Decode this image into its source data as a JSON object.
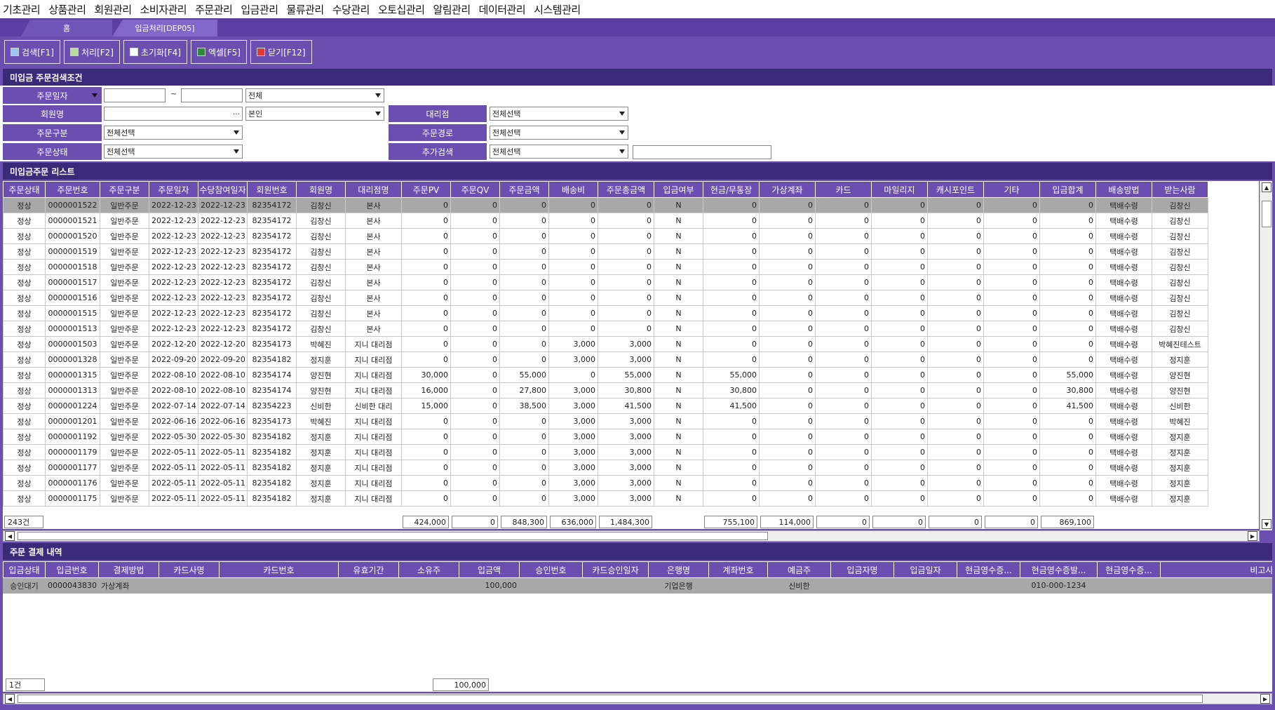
{
  "menu": [
    "기초관리",
    "상품관리",
    "회원관리",
    "소비자관리",
    "주문관리",
    "입금관리",
    "물류관리",
    "수당관리",
    "오토십관리",
    "알림관리",
    "데이터관리",
    "시스템관리"
  ],
  "tabs": {
    "home": "홈",
    "active": "입금처리[DEP05]"
  },
  "toolbar": {
    "search": "검색[F1]",
    "process": "처리[F2]",
    "reset": "초기화[F4]",
    "excel": "엑셀[F5]",
    "close": "닫기[F12]"
  },
  "search_section": {
    "title": "미입금 주문검색조건"
  },
  "form": {
    "order_date_label": "주문일자",
    "order_date_from": "",
    "order_date_to": "",
    "tilde": "~",
    "date_scope": "전체",
    "member_name_label": "회원명",
    "member_name_value": "",
    "member_scope": "본인",
    "agency_label": "대리점",
    "agency_value": "전체선택",
    "order_type_label": "주문구분",
    "order_type_value": "전체선택",
    "order_route_label": "주문경로",
    "order_route_value": "전체선택",
    "order_status_label": "주문상태",
    "order_status_value": "전체선택",
    "extra_search_label": "추가검색",
    "extra_search_value": "전체선택",
    "extra_search_text": ""
  },
  "order_list": {
    "title": "미입금주문 리스트",
    "columns": [
      "주문상태",
      "주문번호",
      "주문구분",
      "주문일자",
      "수당참여일자",
      "회원번호",
      "회원명",
      "대리점명",
      "주문PV",
      "주문QV",
      "주문금액",
      "배송비",
      "주문총금액",
      "입금여부",
      "현금/무통장",
      "가상계좌",
      "카드",
      "마일리지",
      "캐시포인트",
      "기타",
      "입금합계",
      "배송방법",
      "받는사람"
    ],
    "rows": [
      [
        "정상",
        "0000001522",
        "일반주문",
        "2022-12-23",
        "2022-12-23",
        "82354172",
        "김창신",
        "본사",
        "0",
        "0",
        "0",
        "0",
        "0",
        "N",
        "0",
        "0",
        "0",
        "0",
        "0",
        "0",
        "0",
        "택배수령",
        "김창신"
      ],
      [
        "정상",
        "0000001521",
        "일반주문",
        "2022-12-23",
        "2022-12-23",
        "82354172",
        "김창신",
        "본사",
        "0",
        "0",
        "0",
        "0",
        "0",
        "N",
        "0",
        "0",
        "0",
        "0",
        "0",
        "0",
        "0",
        "택배수령",
        "김창신"
      ],
      [
        "정상",
        "0000001520",
        "일반주문",
        "2022-12-23",
        "2022-12-23",
        "82354172",
        "김창신",
        "본사",
        "0",
        "0",
        "0",
        "0",
        "0",
        "N",
        "0",
        "0",
        "0",
        "0",
        "0",
        "0",
        "0",
        "택배수령",
        "김창신"
      ],
      [
        "정상",
        "0000001519",
        "일반주문",
        "2022-12-23",
        "2022-12-23",
        "82354172",
        "김창신",
        "본사",
        "0",
        "0",
        "0",
        "0",
        "0",
        "N",
        "0",
        "0",
        "0",
        "0",
        "0",
        "0",
        "0",
        "택배수령",
        "김창신"
      ],
      [
        "정상",
        "0000001518",
        "일반주문",
        "2022-12-23",
        "2022-12-23",
        "82354172",
        "김창신",
        "본사",
        "0",
        "0",
        "0",
        "0",
        "0",
        "N",
        "0",
        "0",
        "0",
        "0",
        "0",
        "0",
        "0",
        "택배수령",
        "김창신"
      ],
      [
        "정상",
        "0000001517",
        "일반주문",
        "2022-12-23",
        "2022-12-23",
        "82354172",
        "김창신",
        "본사",
        "0",
        "0",
        "0",
        "0",
        "0",
        "N",
        "0",
        "0",
        "0",
        "0",
        "0",
        "0",
        "0",
        "택배수령",
        "김창신"
      ],
      [
        "정상",
        "0000001516",
        "일반주문",
        "2022-12-23",
        "2022-12-23",
        "82354172",
        "김창신",
        "본사",
        "0",
        "0",
        "0",
        "0",
        "0",
        "N",
        "0",
        "0",
        "0",
        "0",
        "0",
        "0",
        "0",
        "택배수령",
        "김창신"
      ],
      [
        "정상",
        "0000001515",
        "일반주문",
        "2022-12-23",
        "2022-12-23",
        "82354172",
        "김창신",
        "본사",
        "0",
        "0",
        "0",
        "0",
        "0",
        "N",
        "0",
        "0",
        "0",
        "0",
        "0",
        "0",
        "0",
        "택배수령",
        "김창신"
      ],
      [
        "정상",
        "0000001513",
        "일반주문",
        "2022-12-23",
        "2022-12-23",
        "82354172",
        "김창신",
        "본사",
        "0",
        "0",
        "0",
        "0",
        "0",
        "N",
        "0",
        "0",
        "0",
        "0",
        "0",
        "0",
        "0",
        "택배수령",
        "김창신"
      ],
      [
        "정상",
        "0000001503",
        "일반주문",
        "2022-12-20",
        "2022-12-20",
        "82354173",
        "박혜진",
        "지니 대리점",
        "0",
        "0",
        "0",
        "3,000",
        "3,000",
        "N",
        "0",
        "0",
        "0",
        "0",
        "0",
        "0",
        "0",
        "택배수령",
        "박혜진테스트"
      ],
      [
        "정상",
        "0000001328",
        "일반주문",
        "2022-09-20",
        "2022-09-20",
        "82354182",
        "정지훈",
        "지니 대리점",
        "0",
        "0",
        "0",
        "3,000",
        "3,000",
        "N",
        "0",
        "0",
        "0",
        "0",
        "0",
        "0",
        "0",
        "택배수령",
        "정지훈"
      ],
      [
        "정상",
        "0000001315",
        "일반주문",
        "2022-08-10",
        "2022-08-10",
        "82354174",
        "양진현",
        "지니 대리점",
        "30,000",
        "0",
        "55,000",
        "0",
        "55,000",
        "N",
        "55,000",
        "0",
        "0",
        "0",
        "0",
        "0",
        "55,000",
        "택배수령",
        "양진현"
      ],
      [
        "정상",
        "0000001313",
        "일반주문",
        "2022-08-10",
        "2022-08-10",
        "82354174",
        "양진현",
        "지니 대리점",
        "16,000",
        "0",
        "27,800",
        "3,000",
        "30,800",
        "N",
        "30,800",
        "0",
        "0",
        "0",
        "0",
        "0",
        "30,800",
        "택배수령",
        "양진현"
      ],
      [
        "정상",
        "0000001224",
        "일반주문",
        "2022-07-14",
        "2022-07-14",
        "82354223",
        "신비한",
        "신비한 대리",
        "15,000",
        "0",
        "38,500",
        "3,000",
        "41,500",
        "N",
        "41,500",
        "0",
        "0",
        "0",
        "0",
        "0",
        "41,500",
        "택배수령",
        "신비한"
      ],
      [
        "정상",
        "0000001201",
        "일반주문",
        "2022-06-16",
        "2022-06-16",
        "82354173",
        "박혜진",
        "지니 대리점",
        "0",
        "0",
        "0",
        "3,000",
        "3,000",
        "N",
        "0",
        "0",
        "0",
        "0",
        "0",
        "0",
        "0",
        "택배수령",
        "박혜진"
      ],
      [
        "정상",
        "0000001192",
        "일반주문",
        "2022-05-30",
        "2022-05-30",
        "82354182",
        "정지훈",
        "지니 대리점",
        "0",
        "0",
        "0",
        "3,000",
        "3,000",
        "N",
        "0",
        "0",
        "0",
        "0",
        "0",
        "0",
        "0",
        "택배수령",
        "정지훈"
      ],
      [
        "정상",
        "0000001179",
        "일반주문",
        "2022-05-11",
        "2022-05-11",
        "82354182",
        "정지훈",
        "지니 대리점",
        "0",
        "0",
        "0",
        "3,000",
        "3,000",
        "N",
        "0",
        "0",
        "0",
        "0",
        "0",
        "0",
        "0",
        "택배수령",
        "정지훈"
      ],
      [
        "정상",
        "0000001177",
        "일반주문",
        "2022-05-11",
        "2022-05-11",
        "82354182",
        "정지훈",
        "지니 대리점",
        "0",
        "0",
        "0",
        "3,000",
        "3,000",
        "N",
        "0",
        "0",
        "0",
        "0",
        "0",
        "0",
        "0",
        "택배수령",
        "정지훈"
      ],
      [
        "정상",
        "0000001176",
        "일반주문",
        "2022-05-11",
        "2022-05-11",
        "82354182",
        "정지훈",
        "지니 대리점",
        "0",
        "0",
        "0",
        "3,000",
        "3,000",
        "N",
        "0",
        "0",
        "0",
        "0",
        "0",
        "0",
        "0",
        "택배수령",
        "정지훈"
      ],
      [
        "정상",
        "0000001175",
        "일반주문",
        "2022-05-11",
        "2022-05-11",
        "82354182",
        "정지훈",
        "지니 대리점",
        "0",
        "0",
        "0",
        "3,000",
        "3,000",
        "N",
        "0",
        "0",
        "0",
        "0",
        "0",
        "0",
        "0",
        "택배수령",
        "정지훈"
      ]
    ],
    "summary": {
      "count": "243건",
      "pv": "424,000",
      "qv": "0",
      "amount": "848,300",
      "shipping": "636,000",
      "total": "1,484,300",
      "cash": "755,100",
      "virtual": "114,000",
      "card": "0",
      "mileage": "0",
      "cashpoint": "0",
      "etc": "0",
      "deposit_total": "869,100"
    }
  },
  "payment_section": {
    "title": "주문 결제 내역"
  },
  "payment_list": {
    "columns": [
      "입금상태",
      "입금번호",
      "결제방법",
      "카드사명",
      "카드번호",
      "유효기간",
      "소유주",
      "입금액",
      "승인번호",
      "카드승인일자",
      "은행명",
      "계좌번호",
      "예금주",
      "입금자명",
      "입금일자",
      "현금영수증...",
      "현금영수증발...",
      "현금영수증...",
      "비고사항"
    ],
    "rows": [
      [
        "승인대기",
        "0000043830",
        "가상계좌",
        "",
        "",
        "",
        "",
        "100,000",
        "",
        "",
        "기업은행",
        "",
        "신비한",
        "",
        "",
        "",
        "010-000-1234",
        "",
        ""
      ]
    ],
    "summary": {
      "count": "1건",
      "amount": "100,000"
    }
  }
}
